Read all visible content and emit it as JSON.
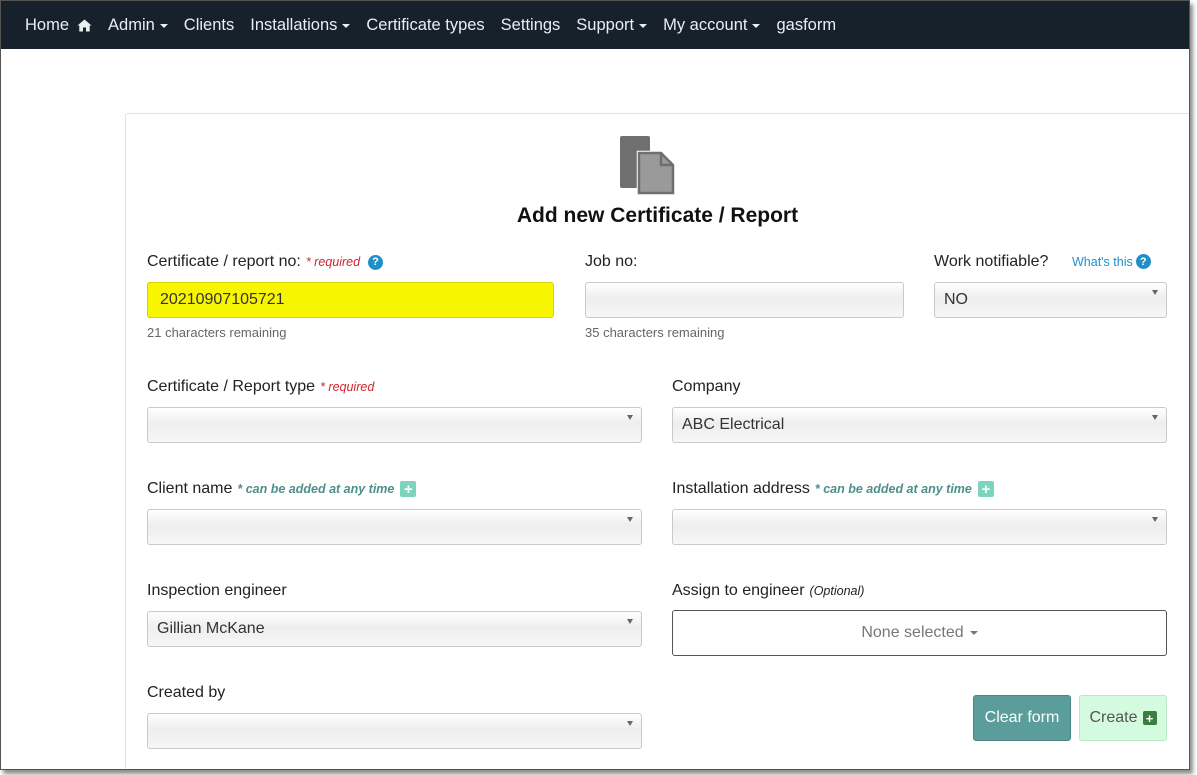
{
  "nav": {
    "home": "Home",
    "admin": "Admin",
    "clients": "Clients",
    "installations": "Installations",
    "certificate_types": "Certificate types",
    "settings": "Settings",
    "support": "Support",
    "my_account": "My account",
    "gasform": "gasform"
  },
  "form": {
    "title": "Add new Certificate / Report",
    "cert_no": {
      "label": "Certificate / report no:",
      "req": "* required",
      "value": "20210907105721",
      "hint": "21 characters remaining"
    },
    "job_no": {
      "label": "Job no:",
      "value": "",
      "hint": "35 characters remaining"
    },
    "work_notifiable": {
      "label": "Work notifiable?",
      "whats_this": "What's this",
      "value": "NO"
    },
    "cert_type": {
      "label": "Certificate / Report type",
      "req": "* required",
      "value": ""
    },
    "company": {
      "label": "Company",
      "value": "ABC Electrical"
    },
    "client_name": {
      "label": "Client name",
      "note": "* can be added at any time",
      "value": ""
    },
    "installation_address": {
      "label": "Installation address",
      "note": "* can be added at any time",
      "value": ""
    },
    "inspection_engineer": {
      "label": "Inspection engineer",
      "value": "Gillian McKane"
    },
    "assign_engineer": {
      "label": "Assign to engineer",
      "optional": "(Optional)",
      "value": "None selected"
    },
    "created_by": {
      "label": "Created by",
      "value": ""
    },
    "buttons": {
      "clear": "Clear form",
      "create": "Create"
    }
  },
  "colors": {
    "navbar": "#17212c",
    "highlight": "#f8f500",
    "clear_button": "#5a9d9a",
    "create_button": "#d4fbe0",
    "required": "#d0262e",
    "help": "#2190c9"
  },
  "icons": [
    "home-icon",
    "caret-down-icon",
    "document-icon",
    "help-icon",
    "add-icon"
  ]
}
